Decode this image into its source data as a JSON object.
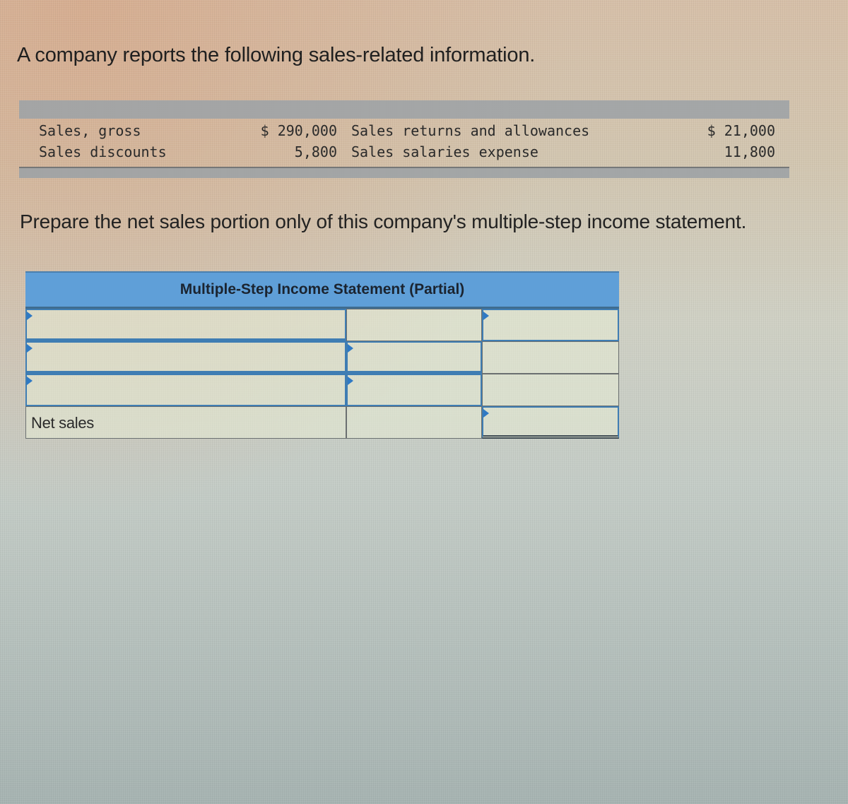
{
  "intro_text": "A company reports the following sales-related information.",
  "data_table": {
    "rows": [
      {
        "label_1": "Sales, gross",
        "amount_1": "$ 290,000",
        "label_2": "Sales returns and allowances",
        "amount_2": "$ 21,000"
      },
      {
        "label_1": "Sales discounts",
        "amount_1": "5,800",
        "label_2": "Sales salaries expense",
        "amount_2": "11,800"
      }
    ]
  },
  "instruction_text": "Prepare the net sales portion only of this company's multiple-step income statement.",
  "statement": {
    "title": "Multiple-Step Income Statement (Partial)",
    "rows": [
      {
        "label": "",
        "col2": "",
        "col3": ""
      },
      {
        "label": "",
        "col2": "",
        "col3": ""
      },
      {
        "label": "",
        "col2": "",
        "col3": ""
      },
      {
        "label": "Net sales",
        "col2": "",
        "col3": ""
      }
    ]
  },
  "colors": {
    "header_blue": "#5f9fd8",
    "input_border": "#3f7db3",
    "marker": "#2f79c4"
  }
}
